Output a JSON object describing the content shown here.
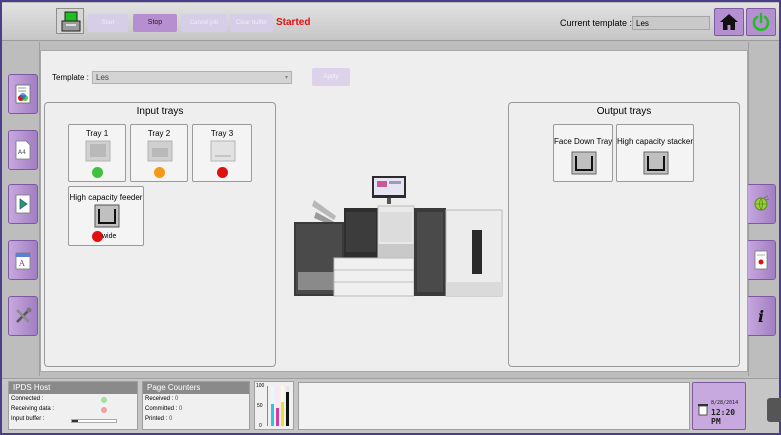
{
  "toolbar": {
    "start_label": "Start",
    "stop_label": "Stop",
    "cancel_job_label": "Cancel job",
    "clear_buffer_label": "Clear buffer",
    "status_text": "Started",
    "current_template_label": "Current template :",
    "current_template_value": "Les",
    "status_color": "#e01010",
    "accent_color": "#b58fd0"
  },
  "template_bar": {
    "label": "Template :",
    "value": "Les",
    "apply_label": "Apply"
  },
  "input_trays": {
    "title": "Input trays",
    "trays": [
      {
        "label": "Tray 1",
        "status": "green",
        "color": "#3ec23e"
      },
      {
        "label": "Tray 2",
        "status": "orange",
        "color": "#f59a16"
      },
      {
        "label": "Tray 3",
        "status": "red",
        "color": "#e01010"
      }
    ],
    "feeder": {
      "label": "High capacity feeder",
      "status": "red",
      "color": "#e01010",
      "note": "wide"
    }
  },
  "output_trays": {
    "title": "Output trays",
    "trays": [
      {
        "label": "Face Down Tray"
      },
      {
        "label": "High capacity stacker"
      }
    ]
  },
  "ipds_host": {
    "title": "IPDS Host",
    "connected_label": "Connected :",
    "receiving_label": "Receiving data :",
    "input_buffer_label": "Input buffer :"
  },
  "page_counters": {
    "title": "Page Counters",
    "received_label": "Received :",
    "received_value": "0",
    "committed_label": "Committed :",
    "committed_value": "0",
    "printed_label": "Printed :",
    "printed_value": "0"
  },
  "gauge": {
    "tick_100": "100",
    "tick_50": "50",
    "tick_0": "0",
    "levels": {
      "cyan": 0.55,
      "magenta": 0.45,
      "yellow": 0.6,
      "black": 0.85
    }
  },
  "clock": {
    "date": "8/28/2014",
    "time": "12:20 PM"
  },
  "icons": {
    "home": "home-icon",
    "power": "power-icon",
    "wrench": "tools-icon",
    "info": "info-icon"
  }
}
